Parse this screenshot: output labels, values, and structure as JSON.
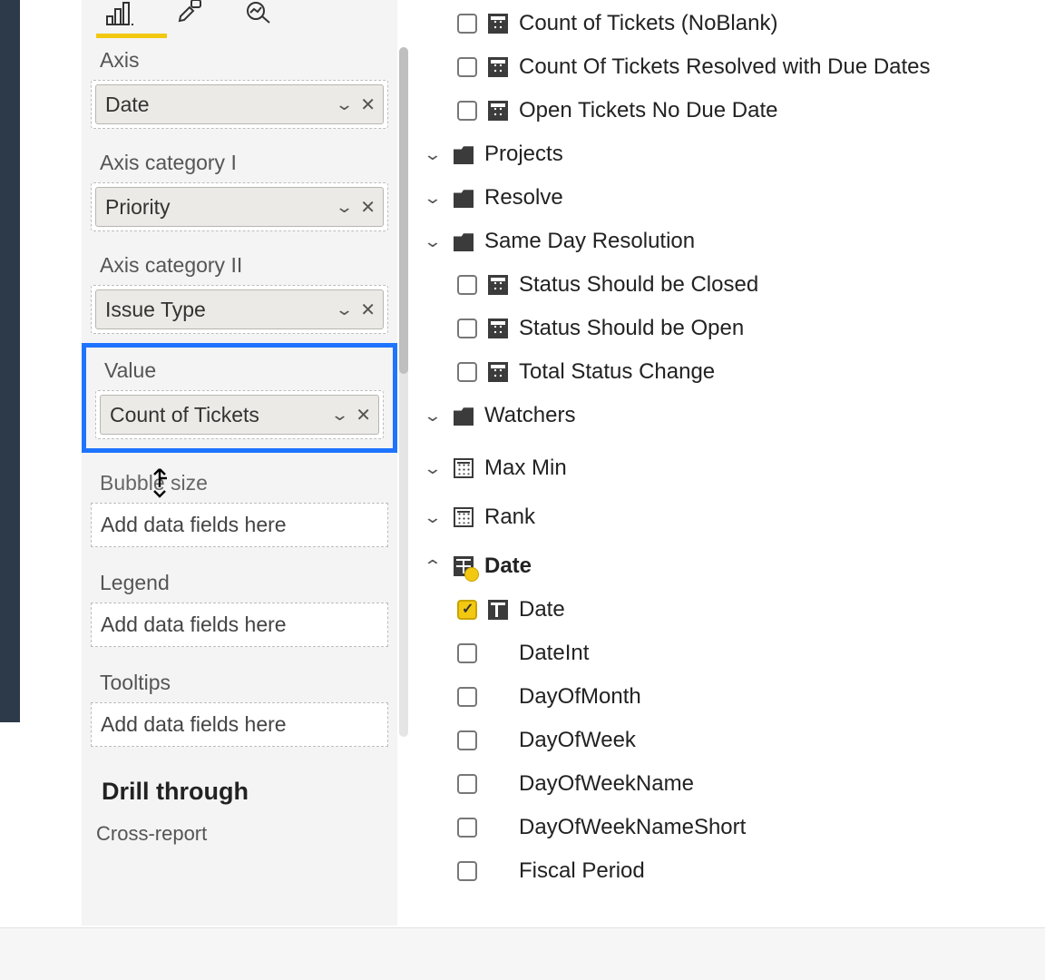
{
  "viz": {
    "wells": {
      "axis": {
        "label": "Axis",
        "value": "Date"
      },
      "axis_cat1": {
        "label": "Axis category I",
        "value": "Priority"
      },
      "axis_cat2": {
        "label": "Axis category II",
        "value": "Issue Type"
      },
      "value": {
        "label": "Value",
        "value": "Count of Tickets"
      },
      "bubble": {
        "label": "Bubble size",
        "placeholder": "Add data fields here"
      },
      "legend": {
        "label": "Legend",
        "placeholder": "Add data fields here"
      },
      "tooltips": {
        "label": "Tooltips",
        "placeholder": "Add data fields here"
      }
    },
    "drill_heading": "Drill through",
    "cross_report": "Cross-report"
  },
  "fields": {
    "measures_top": [
      "Count of Tickets (NoBlank)",
      "Count Of Tickets Resolved with Due Dates",
      "Open Tickets No Due Date"
    ],
    "folders": {
      "projects": "Projects",
      "resolve": "Resolve",
      "same_day": "Same Day Resolution",
      "watchers": "Watchers"
    },
    "same_day_children": [
      "Status Should be Closed",
      "Status Should be Open",
      "Total Status Change"
    ],
    "calc_tables": {
      "maxmin": "Max Min",
      "rank": "Rank"
    },
    "date_table": "Date",
    "date_columns": [
      {
        "name": "Date",
        "checked": true,
        "icon": "col"
      },
      {
        "name": "DateInt",
        "checked": false,
        "icon": "none"
      },
      {
        "name": "DayOfMonth",
        "checked": false,
        "icon": "none"
      },
      {
        "name": "DayOfWeek",
        "checked": false,
        "icon": "none"
      },
      {
        "name": "DayOfWeekName",
        "checked": false,
        "icon": "none"
      },
      {
        "name": "DayOfWeekNameShort",
        "checked": false,
        "icon": "none"
      },
      {
        "name": "Fiscal Period",
        "checked": false,
        "icon": "none"
      }
    ]
  }
}
